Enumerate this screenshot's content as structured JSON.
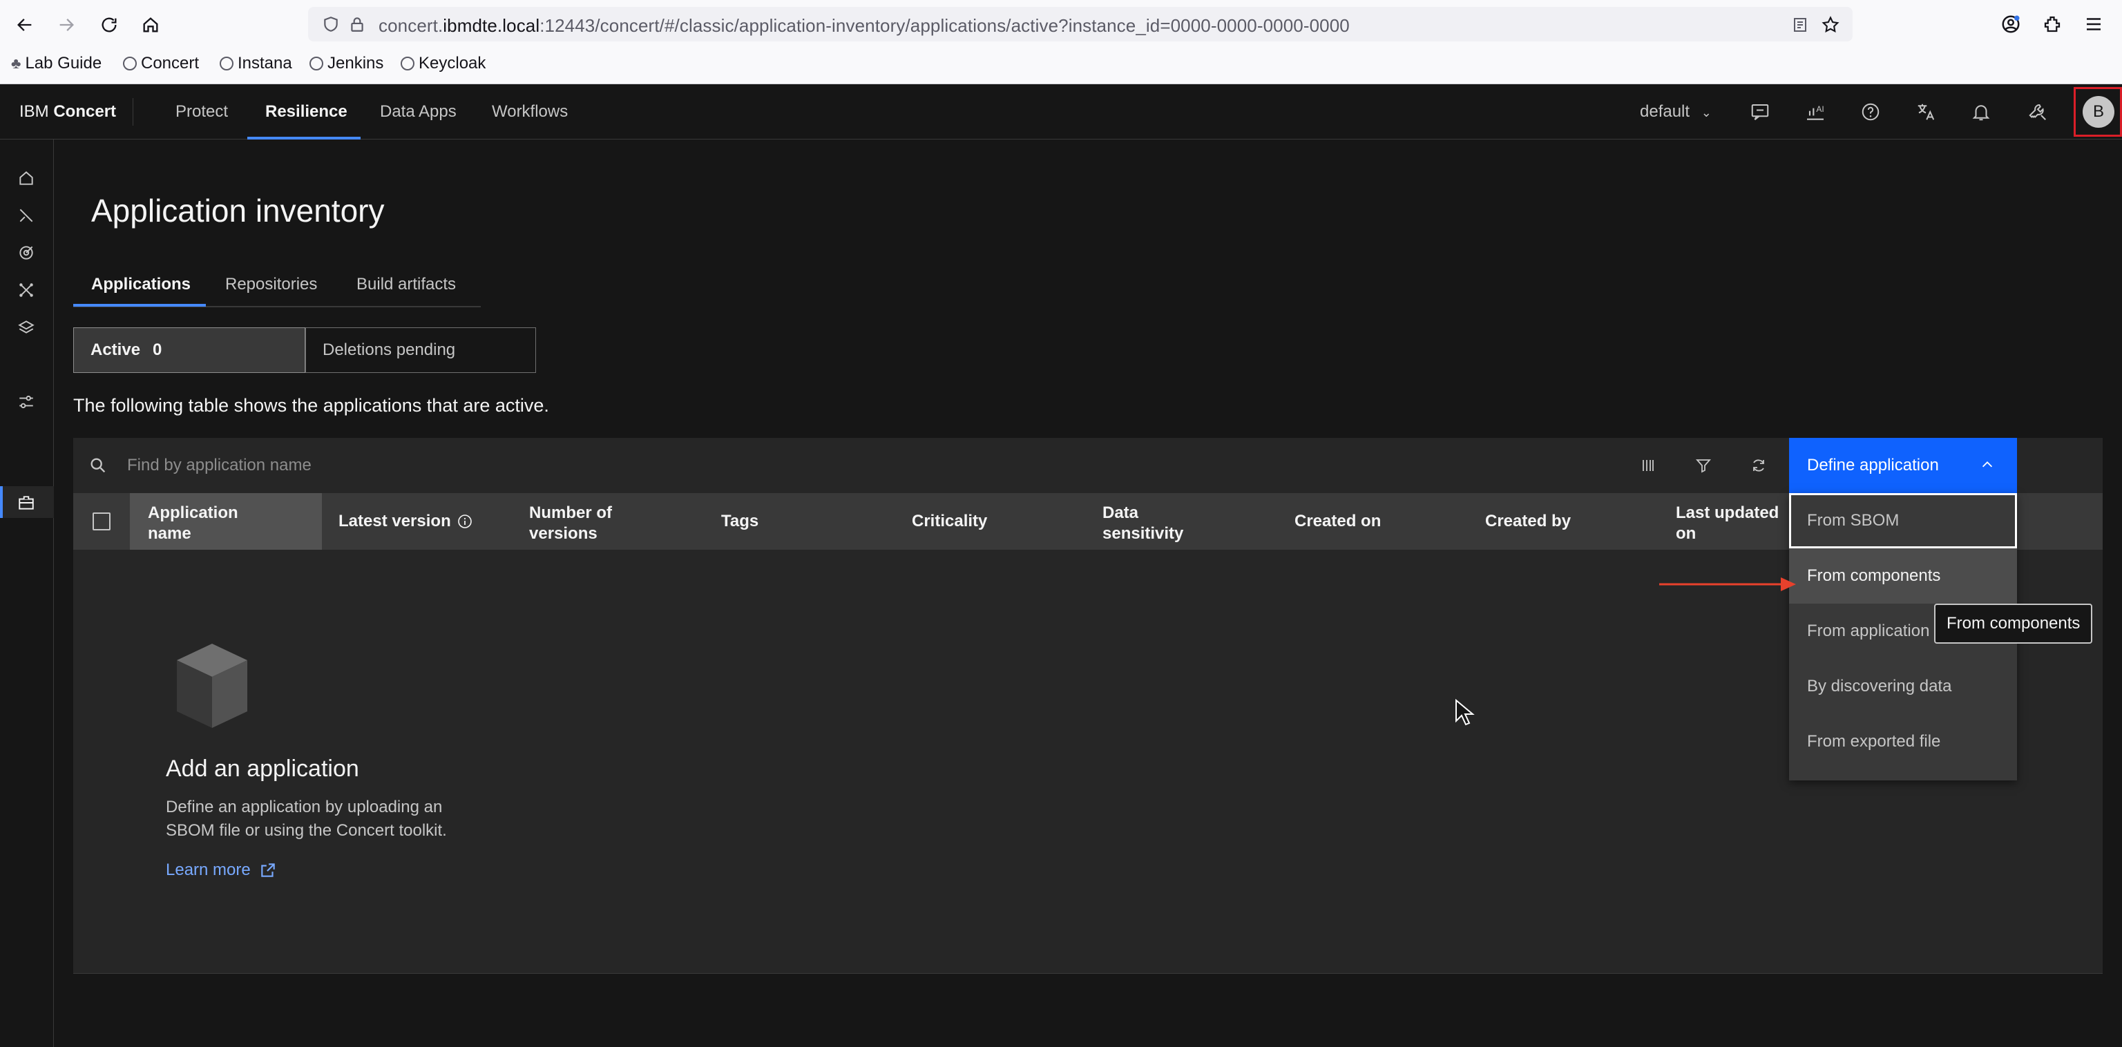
{
  "browser": {
    "url_prefix": "concert.",
    "url_host": "ibmdte.local",
    "url_rest": ":12443/concert/#/classic/application-inventory/applications/active?instance_id=0000-0000-0000-0000",
    "bookmarks": [
      "Lab Guide",
      "Concert",
      "Instana",
      "Jenkins",
      "Keycloak"
    ]
  },
  "header": {
    "brand_prefix": "IBM ",
    "brand_name": "Concert",
    "nav": [
      "Protect",
      "Resilience",
      "Data Apps",
      "Workflows"
    ],
    "active_nav": "Resilience",
    "instance_select": "default",
    "avatar_initial": "B"
  },
  "page": {
    "title": "Application inventory",
    "tabs": [
      "Applications",
      "Repositories",
      "Build artifacts"
    ],
    "active_tab": "Applications",
    "segments": {
      "active_label": "Active",
      "active_count": "0",
      "deletions_label": "Deletions pending"
    },
    "description": "The following table shows the applications that are active."
  },
  "table": {
    "search_placeholder": "Find by application name",
    "define_button": "Define application",
    "columns": [
      [
        "Application",
        "name"
      ],
      [
        "Latest version"
      ],
      [
        "Number of",
        "versions"
      ],
      [
        "Tags"
      ],
      [
        "Criticality"
      ],
      [
        "Data",
        "sensitivity"
      ],
      [
        "Created on"
      ],
      [
        "Created by"
      ],
      [
        "Last updated",
        "on"
      ]
    ],
    "empty_state": {
      "title": "Add an application",
      "body": "Define an application by uploading an SBOM file or using the Concert toolkit.",
      "link": "Learn more"
    }
  },
  "menu": {
    "items": [
      "From SBOM",
      "From components",
      "From application",
      "By discovering data",
      "From exported file"
    ],
    "focused": "From SBOM",
    "hovered": "From components"
  },
  "tooltip": "From components",
  "colors": {
    "accent": "#0f62fe",
    "link": "#78a9ff",
    "highlight_box": "#da1e28",
    "arrow": "#e8412c"
  }
}
